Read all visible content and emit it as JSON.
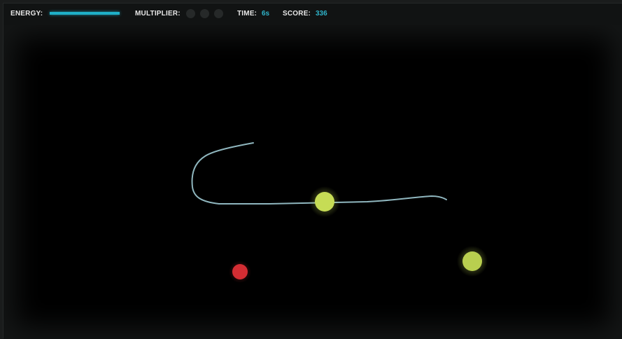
{
  "hud": {
    "energy_label": "ENERGY:",
    "energy_level": 1.0,
    "multiplier_label": "MULTIPLIER:",
    "multiplier_slots": 3,
    "multiplier_active": 0,
    "time_label": "TIME:",
    "time_value": "6s",
    "score_label": "SCORE:",
    "score_value": "336"
  },
  "colors": {
    "accent": "#2fb3c9",
    "energy_bar": "#1fb0c8",
    "trail": "#8fb6be",
    "orb_yellow": "#c6dc55",
    "orb_red": "#d42d33",
    "multiplier_off": "#262929"
  },
  "game": {
    "entities": [
      {
        "kind": "player-orb",
        "color": "yellow"
      },
      {
        "kind": "energy-orb",
        "color": "yellow"
      },
      {
        "kind": "enemy-orb",
        "color": "red"
      }
    ]
  }
}
